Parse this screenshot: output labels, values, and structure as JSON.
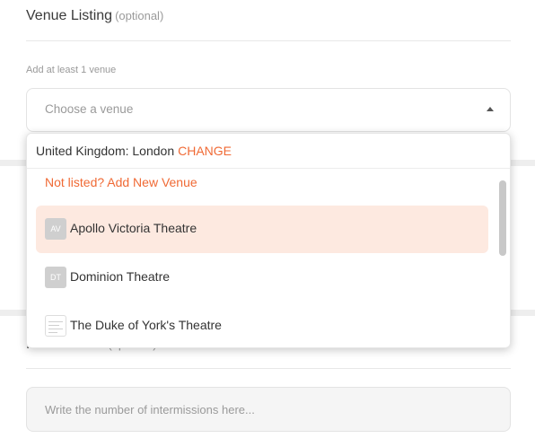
{
  "venue_section": {
    "title": "Venue Listing",
    "optional": "(optional)",
    "hint": "Add at least 1 venue",
    "select_placeholder": "Choose a venue"
  },
  "dropdown": {
    "location": "United Kingdom: London",
    "change_label": "CHANGE",
    "add_new_label": "Not listed? Add New Venue",
    "options": [
      {
        "initials": "AV",
        "name": "Apollo Victoria Theatre"
      },
      {
        "initials": "DT",
        "name": "Dominion Theatre"
      },
      {
        "initials": "",
        "name": "The Duke of York's Theatre"
      }
    ]
  },
  "intermissions_section": {
    "title": "Intermissions",
    "optional": "(optional)",
    "input_placeholder": "Write the number of intermissions here..."
  },
  "colors": {
    "accent": "#f06a35",
    "highlight": "#fde9e0"
  },
  "icons": {
    "select_caret": "caret-up-icon"
  }
}
